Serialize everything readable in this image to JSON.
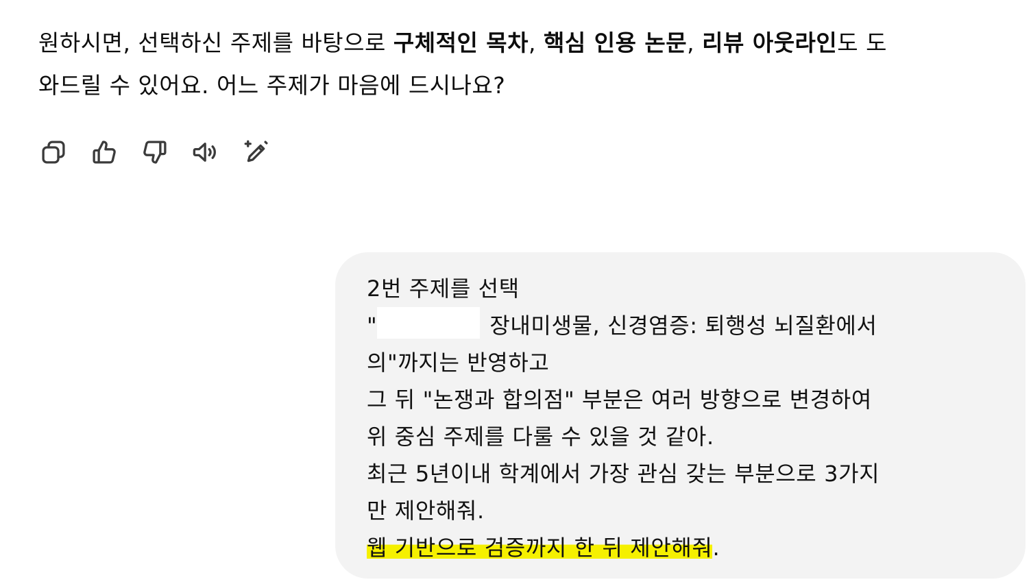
{
  "assistant": {
    "line1": {
      "t0": "원하시면, 선택하신 주제를 바탕으로 ",
      "b0": "구체적인 목차",
      "t1": ", ",
      "b1": "핵심 인용 논문",
      "t2": ", ",
      "b2": "리뷰 아웃라인",
      "t3": "도 도"
    },
    "line2": "와드릴 수 있어요. 어느 주제가 마음에 드시나요?"
  },
  "actions": [
    {
      "icon": "copy-icon",
      "label": "Copy"
    },
    {
      "icon": "thumbs-up-icon",
      "label": "Good response"
    },
    {
      "icon": "thumbs-down-icon",
      "label": "Bad response"
    },
    {
      "icon": "speaker-icon",
      "label": "Read aloud"
    },
    {
      "icon": "edit-sparkle-icon",
      "label": "Edit"
    }
  ],
  "user": {
    "line1": "2번 주제를 선택",
    "line2_prefix": "\"",
    "line2_text": "장내미생물, 신경염증: 퇴행성 뇌질환에서",
    "line3": "의\"까지는 반영하고",
    "line4": "그 뒤 \"논쟁과 합의점\" 부분은  여러 방향으로 변경하여",
    "line5": "위 중심 주제를 다룰 수 있을 것 같아.",
    "line6": "최근 5년이내 학계에서 가장 관심 갖는 부분으로 3가지",
    "line7": "만 제안해줘.",
    "line8_highlight": "웹 기반으로 검증까지 한 뒤 제안해줘",
    "line8_tail": "."
  },
  "colors": {
    "highlight": "#f5f000",
    "bubble": "#f3f3f3",
    "text": "#0d0d0d"
  }
}
